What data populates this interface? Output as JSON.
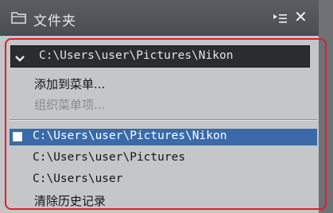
{
  "panel": {
    "title": "文件夹",
    "icons": {
      "folder": "folder-icon",
      "menu": "panel-menu-icon",
      "close": "close-icon"
    },
    "close_glyph": "✕"
  },
  "path_bar": {
    "dropdown_icon": "chevron-down-icon",
    "current_path": "C:\\Users\\user\\Pictures\\Nikon"
  },
  "menu": {
    "add_to_favorites": "添加到菜单...",
    "organize_favorites": "组织菜单项...",
    "history": [
      {
        "path": "C:\\Users\\user\\Pictures\\Nikon",
        "selected": true
      },
      {
        "path": "C:\\Users\\user\\Pictures",
        "selected": false
      },
      {
        "path": "C:\\Users\\user",
        "selected": false
      }
    ],
    "clear_history": "清除历史记录"
  },
  "colors": {
    "highlight": "#e0202a",
    "selected_bg": "#3a6aa8",
    "panel_bg": "#c4c6c8",
    "titlebar_bg": "#4b4e52"
  }
}
